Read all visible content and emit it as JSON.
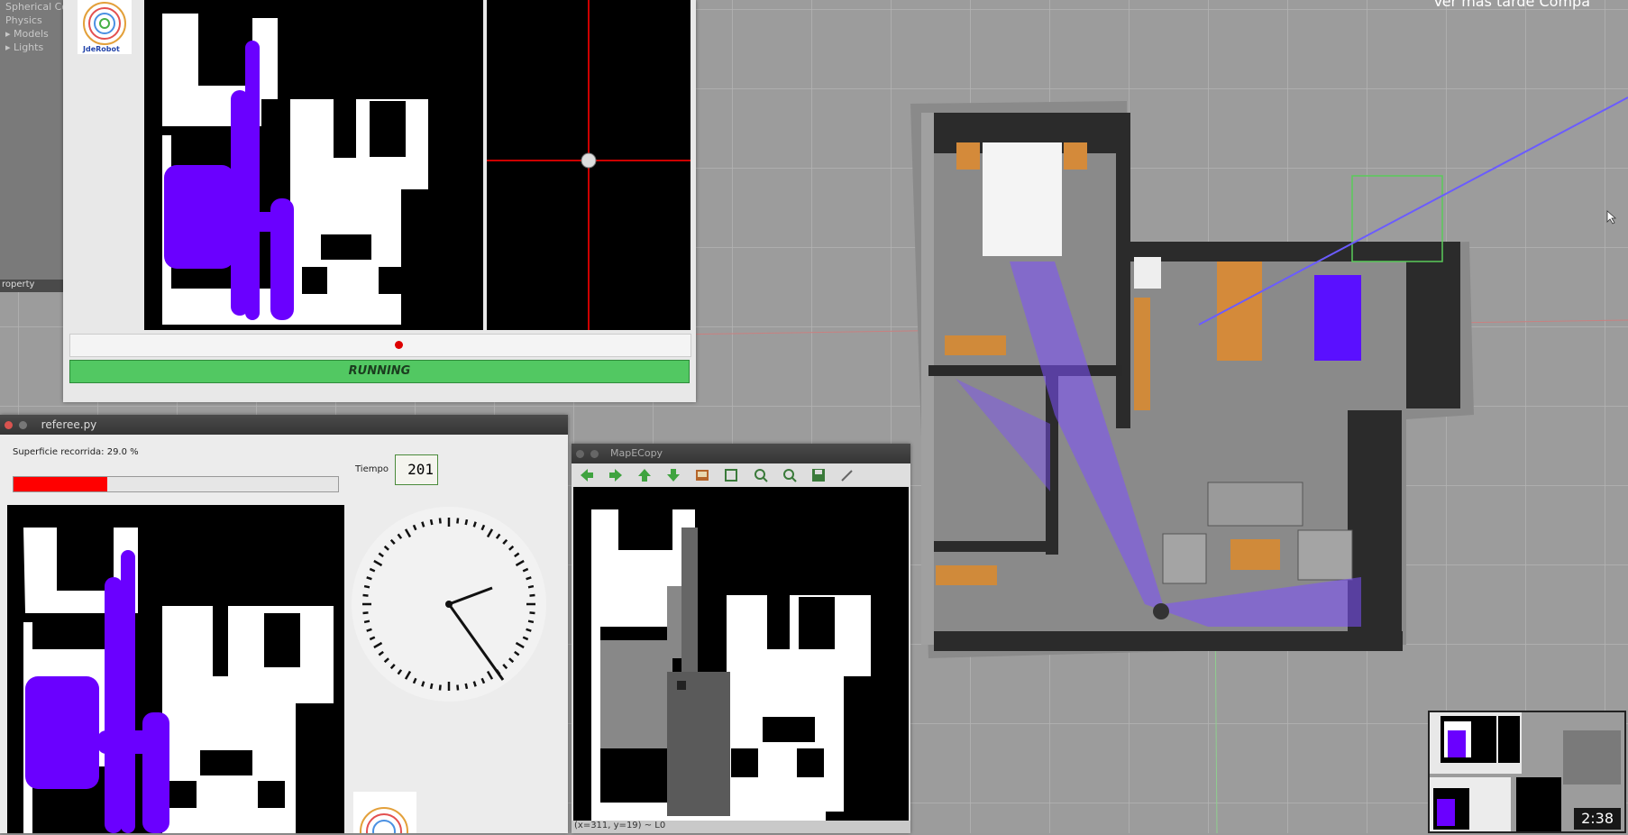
{
  "sidebar": {
    "items": [
      "Spherical Co",
      "Physics",
      "▸ Models",
      "▸ Lights"
    ],
    "property_label": "roperty"
  },
  "video_overlay_text": "Ver más tarde    Compa",
  "jde_window": {
    "logo_text": "JdeRobot",
    "status": "RUNNING"
  },
  "referee_window": {
    "title": "referee.py",
    "coverage_label": "Superficie recorrida: 29.0 %",
    "coverage_percent": 29.0,
    "time_label": "Tiempo",
    "time_value": "201"
  },
  "map_window": {
    "title": "MapECopy",
    "toolbar_icons": [
      "arrow-left-icon",
      "arrow-right-icon",
      "arrow-up-icon",
      "arrow-down-icon",
      "save-image-icon",
      "fit-icon",
      "zoom-in-icon",
      "zoom-out-icon",
      "save-icon",
      "settings-icon"
    ],
    "status": "(x=311, y=19) ~ L0"
  },
  "thumbnail": {
    "duration": "2:38"
  },
  "colors": {
    "path": "#6a00ff",
    "running": "#52c862",
    "progress": "#ff0000"
  }
}
